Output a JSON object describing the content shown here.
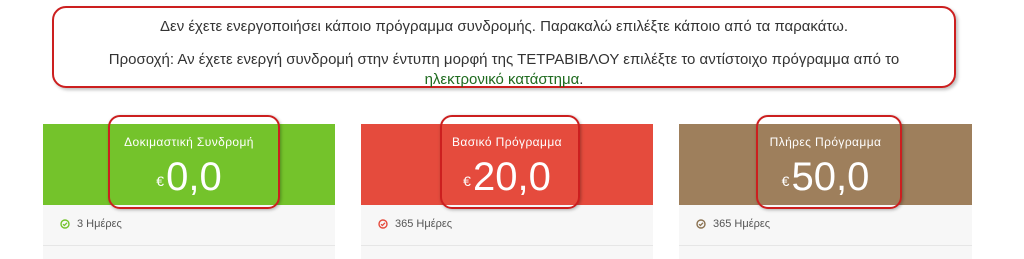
{
  "notice": {
    "line1": "Δεν έχετε ενεργοποιήσει κάποιο πρόγραμμα συνδρομής. Παρακαλώ επιλέξτε κάποιο από τα παρακάτω.",
    "line2": "Προσοχή: Αν έχετε ενεργή συνδρομή στην έντυπη μορφή της ΤΕΤΡΑΒΙΒΛΟΥ επιλέξτε το αντίστοιχο πρόγραμμα από το",
    "link": "ηλεκτρονικό κατάστημα",
    "after_link": "."
  },
  "plans": [
    {
      "title": "Δοκιμαστική Συνδρομή",
      "currency": "€",
      "price": "0,0",
      "feature": "3 Ημέρες",
      "color": "#74c32b",
      "icon": "check-circle-icon",
      "icon_color": "#74c32b"
    },
    {
      "title": "Βασικό Πρόγραμμα",
      "currency": "€",
      "price": "20,0",
      "feature": "365 Ημέρες",
      "color": "#e54b3d",
      "icon": "check-circle-icon",
      "icon_color": "#e54b3d"
    },
    {
      "title": "Πλήρες Πρόγραμμα",
      "currency": "€",
      "price": "50,0",
      "feature": "365 Ημέρες",
      "color": "#9e7f5c",
      "icon": "check-circle-icon",
      "icon_color": "#8a7150"
    }
  ]
}
